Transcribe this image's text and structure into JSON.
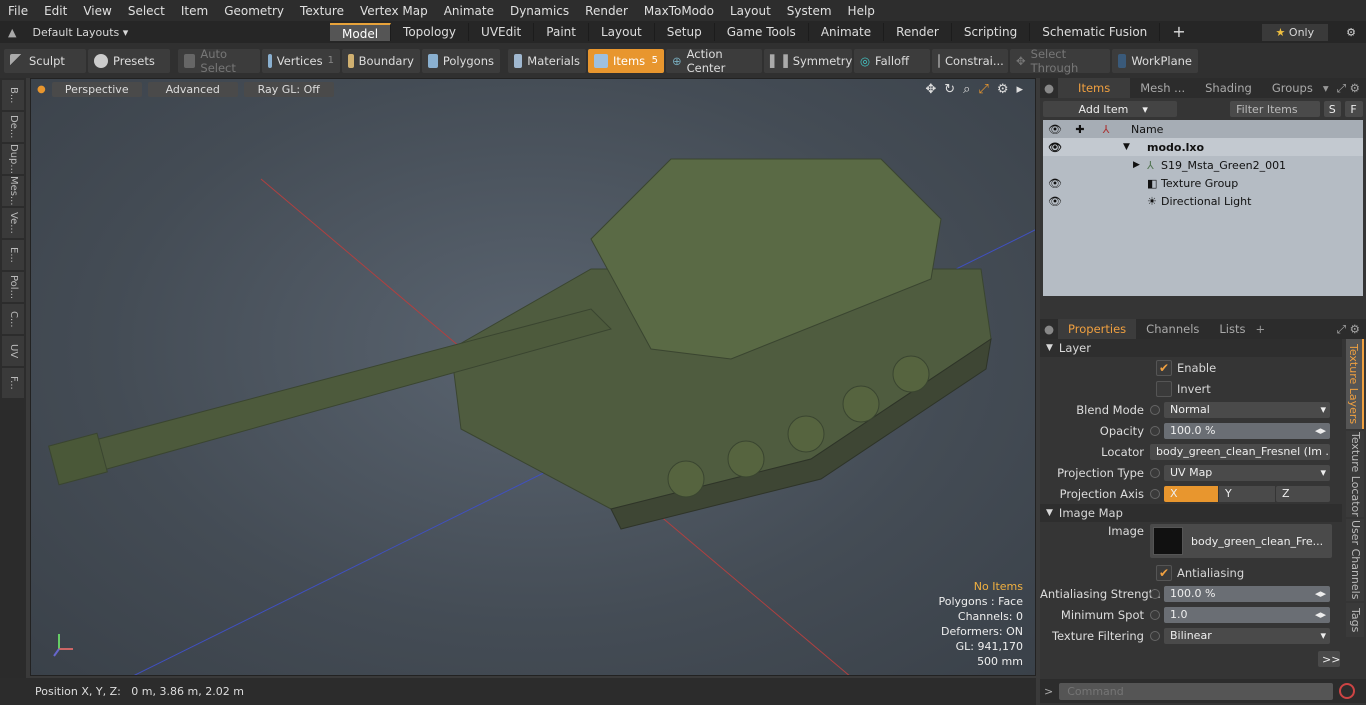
{
  "menu": [
    "File",
    "Edit",
    "View",
    "Select",
    "Item",
    "Geometry",
    "Texture",
    "Vertex Map",
    "Animate",
    "Dynamics",
    "Render",
    "MaxToModo",
    "Layout",
    "System",
    "Help"
  ],
  "layout_selector": "Default Layouts",
  "layout_tabs": [
    "Model",
    "Topology",
    "UVEdit",
    "Paint",
    "Layout",
    "Setup",
    "Game Tools",
    "Animate",
    "Render",
    "Scripting",
    "Schematic Fusion"
  ],
  "only_label": "Only",
  "toolbar": {
    "sculpt": "Sculpt",
    "presets": "Presets",
    "auto_select": "Auto Select",
    "vertices": "Vertices",
    "vertices_count": "1",
    "boundary": "Boundary",
    "polygons": "Polygons",
    "materials": "Materials",
    "items": "Items",
    "items_count": "5",
    "action_center": "Action Center",
    "symmetry": "Symmetry",
    "falloff": "Falloff",
    "constraints": "Constrai...",
    "select_through": "Select Through",
    "workplane": "WorkPlane"
  },
  "left_tabs": [
    "B...",
    "De...",
    "Dup...",
    "Mes...",
    "Ve...",
    "E...",
    "Pol...",
    "C...",
    "UV",
    "F..."
  ],
  "viewport": {
    "perspective": "Perspective",
    "advanced": "Advanced",
    "raygl": "Ray GL: Off",
    "info_title": "No Items",
    "info_lines": [
      "Polygons : Face",
      "Channels: 0",
      "Deformers: ON",
      "GL: 941,170",
      "500 mm"
    ]
  },
  "status": "Position X, Y, Z:   0 m, 3.86 m, 2.02 m",
  "items_panel": {
    "tabs": [
      "Items",
      "Mesh ...",
      "Shading",
      "Groups"
    ],
    "add_item": "Add Item",
    "filter": "Filter Items",
    "s_btn": "S",
    "f_btn": "F",
    "name_header": "Name",
    "tree": [
      "modo.lxo",
      "S19_Msta_Green2_001",
      "Texture Group",
      "Directional Light"
    ]
  },
  "props_panel": {
    "tabs": [
      "Properties",
      "Channels",
      "Lists"
    ],
    "section_layer": "Layer",
    "enable": "Enable",
    "invert": "Invert",
    "blend_mode_label": "Blend Mode",
    "blend_mode": "Normal",
    "opacity_label": "Opacity",
    "opacity": "100.0 %",
    "locator_label": "Locator",
    "locator": "body_green_clean_Fresnel (Im ...",
    "proj_type_label": "Projection Type",
    "proj_type": "UV Map",
    "proj_axis_label": "Projection Axis",
    "axis": [
      "X",
      "Y",
      "Z"
    ],
    "section_image": "Image Map",
    "image_label": "Image",
    "image": "body_green_clean_Fre...",
    "antialiasing": "Antialiasing",
    "aa_strength_label": "Antialiasing Strength",
    "aa_strength": "100.0 %",
    "min_spot_label": "Minimum Spot",
    "min_spot": "1.0",
    "tex_filter_label": "Texture Filtering",
    "tex_filter": "Bilinear",
    "more": ">>",
    "side_tabs": [
      "Texture Layers",
      "Texture Locator",
      "User Channels",
      "Tags"
    ]
  },
  "command_placeholder": "Command",
  "colors": {
    "accent": "#e8962e",
    "tank": "#5a6a45"
  }
}
